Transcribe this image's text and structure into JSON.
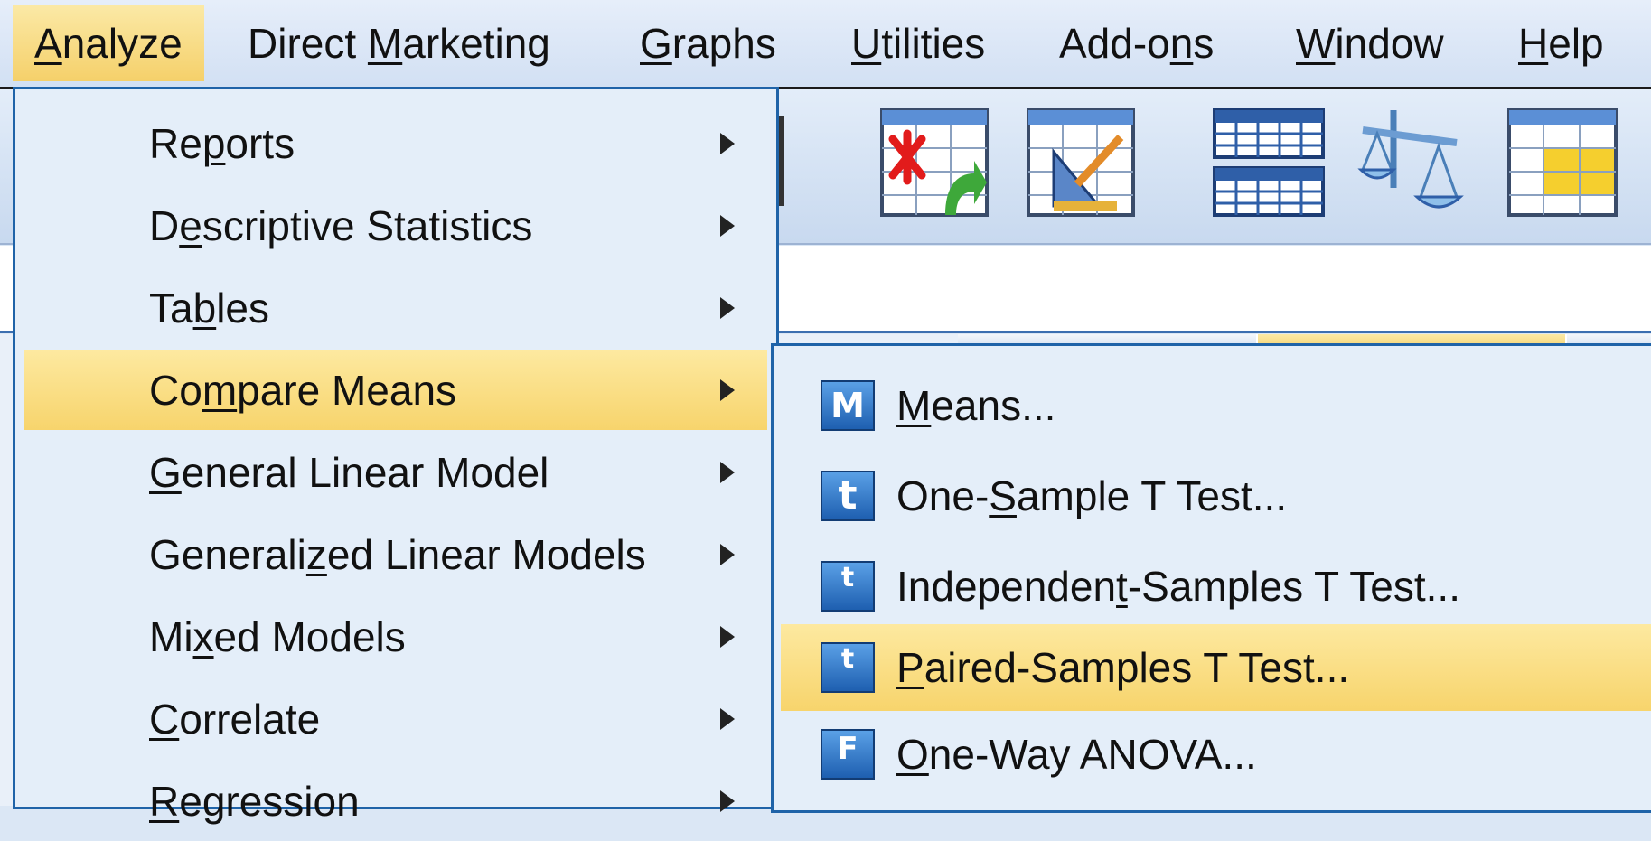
{
  "menubar": {
    "items": [
      {
        "label": "Analyze",
        "mnemonic_index": 0
      },
      {
        "label": "Direct Marketing",
        "mnemonic_index": 7
      },
      {
        "label": "Graphs",
        "mnemonic_index": 0
      },
      {
        "label": "Utilities",
        "mnemonic_index": 0
      },
      {
        "label": "Add-ons",
        "mnemonic_index": 5
      },
      {
        "label": "Window",
        "mnemonic_index": 0
      },
      {
        "label": "Help",
        "mnemonic_index": 0
      }
    ],
    "active": "Analyze"
  },
  "toolbar": {
    "icons": [
      "go-to-case-icon",
      "select-cases-icon",
      "split-file-icon",
      "weight-cases-icon",
      "value-labels-icon"
    ]
  },
  "analyze_menu": {
    "items": [
      {
        "pre": "Re",
        "u": "p",
        "post": "orts"
      },
      {
        "pre": "D",
        "u": "e",
        "post": "scriptive Statistics"
      },
      {
        "pre": "Ta",
        "u": "b",
        "post": "les"
      },
      {
        "pre": "Co",
        "u": "m",
        "post": "pare Means"
      },
      {
        "pre": "",
        "u": "G",
        "post": "eneral Linear Model"
      },
      {
        "pre": "Generali",
        "u": "z",
        "post": "ed Linear Models"
      },
      {
        "pre": "Mi",
        "u": "x",
        "post": "ed Models"
      },
      {
        "pre": "",
        "u": "C",
        "post": "orrelate"
      },
      {
        "pre": "",
        "u": "R",
        "post": "egression"
      }
    ],
    "highlighted": "Compare Means"
  },
  "compare_means_submenu": {
    "items": [
      {
        "icon": "means-icon",
        "glyph": "M",
        "pre": "",
        "u": "M",
        "post": "eans..."
      },
      {
        "icon": "t-test-icon",
        "glyph": "t",
        "pre": "One-",
        "u": "S",
        "post": "ample T Test..."
      },
      {
        "icon": "independent-t-icon",
        "glyph": "t",
        "pre": "Independen",
        "u": "t",
        "post": "-Samples T Test..."
      },
      {
        "icon": "paired-t-icon",
        "glyph": "t",
        "pre": "",
        "u": "P",
        "post": "aired-Samples T Test..."
      },
      {
        "icon": "anova-icon",
        "glyph": "F",
        "pre": "",
        "u": "O",
        "post": "ne-Way ANOVA..."
      }
    ],
    "highlighted": "Paired-Samples T Test..."
  }
}
